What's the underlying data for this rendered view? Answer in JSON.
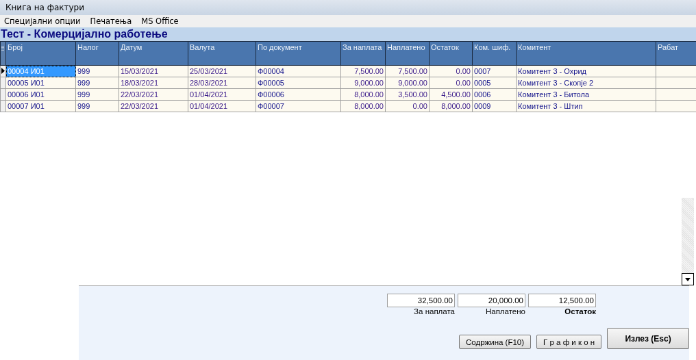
{
  "window": {
    "title": "Книга на фактури"
  },
  "menu": [
    "Специјални опции",
    "Печатења",
    "MS Office"
  ],
  "heading": "Тест - Комерцијално работење",
  "table": {
    "columns": [
      "Број",
      "Налог",
      "Датум",
      "Валута",
      "По документ",
      "За наплата",
      "Наплатено",
      "Остаток",
      "Ком. шиф.",
      "Комитент",
      "Рабат"
    ],
    "rows": [
      {
        "selected": true,
        "cells": [
          "00004  И01",
          "999",
          "15/03/2021",
          "25/03/2021",
          "Ф00004",
          "7,500.00",
          "7,500.00",
          "0.00",
          "0007",
          "Комитент 3 - Охрид",
          ""
        ]
      },
      {
        "selected": false,
        "cells": [
          "00005  И01",
          "999",
          "18/03/2021",
          "28/03/2021",
          "Ф00005",
          "9,000.00",
          "9,000.00",
          "0.00",
          "0005",
          "Комитент 3 - Скопје 2",
          ""
        ]
      },
      {
        "selected": false,
        "cells": [
          "00006  И01",
          "999",
          "22/03/2021",
          "01/04/2021",
          "Ф00006",
          "8,000.00",
          "3,500.00",
          "4,500.00",
          "0006",
          "Комитент 3 - Битола",
          ""
        ]
      },
      {
        "selected": false,
        "cells": [
          "00007  И01",
          "999",
          "22/03/2021",
          "01/04/2021",
          "Ф00007",
          "8,000.00",
          "0.00",
          "8,000.00",
          "0009",
          "Комитент 3 - Штип",
          ""
        ]
      }
    ]
  },
  "totals": [
    {
      "value": "32,500.00",
      "label": "За наплата",
      "bold": false
    },
    {
      "value": "20,000.00",
      "label": "Наплатено",
      "bold": false
    },
    {
      "value": "12,500.00",
      "label": "Остаток",
      "bold": true
    }
  ],
  "buttons": [
    {
      "label": "Содржина (F10)",
      "kind": "normal"
    },
    {
      "label": "Г р а ф и к о н",
      "kind": "normal"
    },
    {
      "label": "Излез (Esc)",
      "kind": "primary"
    }
  ]
}
